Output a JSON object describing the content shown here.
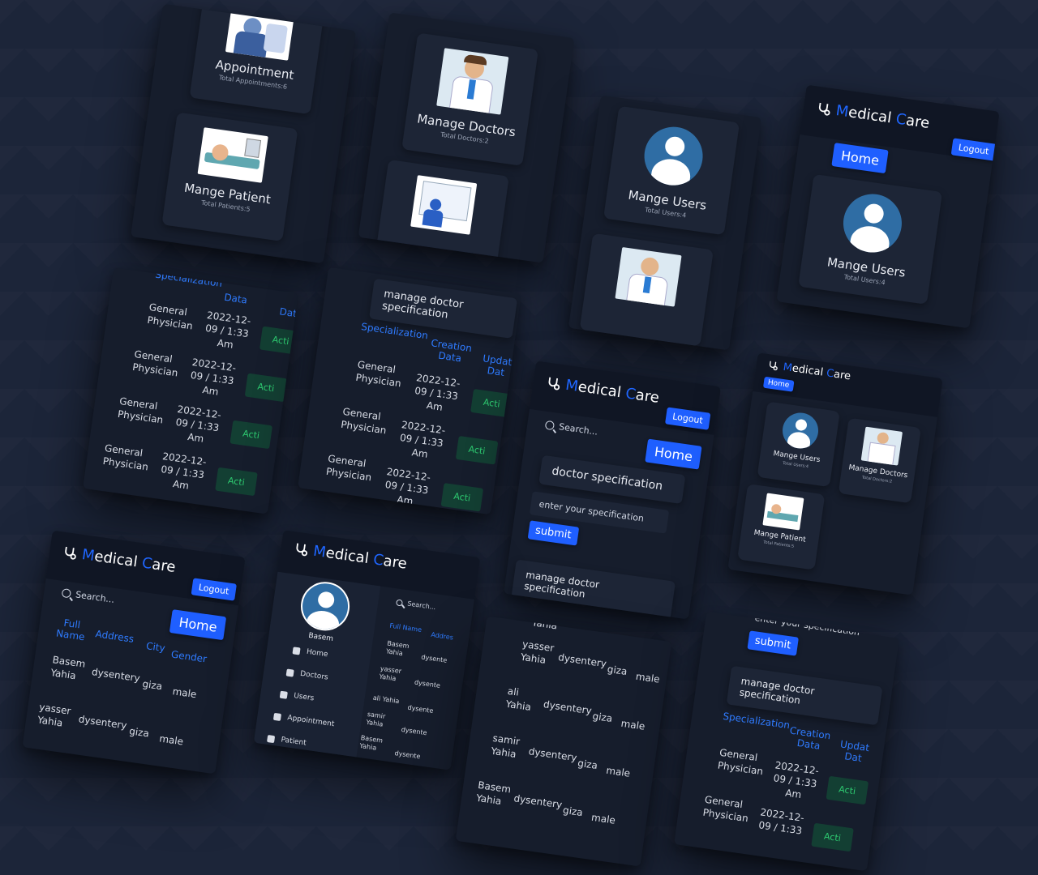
{
  "brand": {
    "prefix_m": "M",
    "text_edical": "edical ",
    "prefix_c": "C",
    "text_are": "are"
  },
  "nav": {
    "home": "Home",
    "logout": "Logout"
  },
  "search": {
    "placeholder": "Search..."
  },
  "cards": {
    "appointment": {
      "title": "Appointment",
      "sub": "Total Appointments:6"
    },
    "patients": {
      "title": "Mange Patient",
      "sub": "Total Patients:5"
    },
    "doctors": {
      "title": "Manage Doctors",
      "sub": "Total Doctors:2"
    },
    "users": {
      "title": "Mange Users",
      "sub": "Total Users:4"
    }
  },
  "spec": {
    "section_title": "manage doctor specification",
    "form_title": "doctor specification",
    "input_placeholder": "enter your specification",
    "submit": "submit",
    "input_partial": "enter your specification",
    "head_partial": "Specialization",
    "cols": {
      "specialization": "Specialization",
      "creation": "Creation",
      "data": "Data",
      "update": "Updat",
      "update_data": "Dat",
      "date": "Data",
      "date2": "Dat"
    },
    "rows": [
      {
        "name1": "General",
        "name2": "Physician",
        "date1": "2022-12-",
        "date2": "09 / 1:33",
        "date3": "Am",
        "status": "Acti"
      },
      {
        "name1": "General",
        "name2": "Physician",
        "date1": "2022-12-",
        "date2": "09 / 1:33",
        "date3": "Am",
        "status": "Acti"
      },
      {
        "name1": "General",
        "name2": "Physician",
        "date1": "2022-12-",
        "date2": "09 / 1:33",
        "date3": "Am",
        "status": "Acti"
      },
      {
        "name1": "General",
        "name2": "Physician",
        "date1": "2022-12-",
        "date2": "09 / 1:33",
        "date3": "Am",
        "status": "Acti"
      }
    ]
  },
  "patients_table": {
    "cols": {
      "full": "Full",
      "name": "Name",
      "address": "Address",
      "city": "City",
      "gender": "Gender",
      "addr_short": "Addres"
    },
    "rows": [
      {
        "first": "Basem",
        "last": "Yahia",
        "disease": "dysentery",
        "city": "giza",
        "gender": "male"
      },
      {
        "first": "yasser",
        "last": "Yahia",
        "disease": "dysentery",
        "city": "giza",
        "gender": "male"
      },
      {
        "first": "ali",
        "last": "Yahia",
        "disease": "dysentery",
        "city": "giza",
        "gender": "male"
      },
      {
        "first": "samir",
        "last": "Yahia",
        "disease": "dysentery",
        "city": "giza",
        "gender": "male"
      },
      {
        "first": "Basem",
        "last": "Yahia",
        "disease": "dysentery",
        "city": "giza",
        "gender": "male"
      }
    ],
    "fullname_head": "Full Name",
    "cut_top": "Yahia"
  },
  "sidebar": {
    "user": "Basem",
    "items": [
      "Home",
      "Doctors",
      "Users",
      "Appointment",
      "Patient"
    ],
    "short": {
      "ali": "ali Yahia",
      "dys": "dysente"
    }
  }
}
